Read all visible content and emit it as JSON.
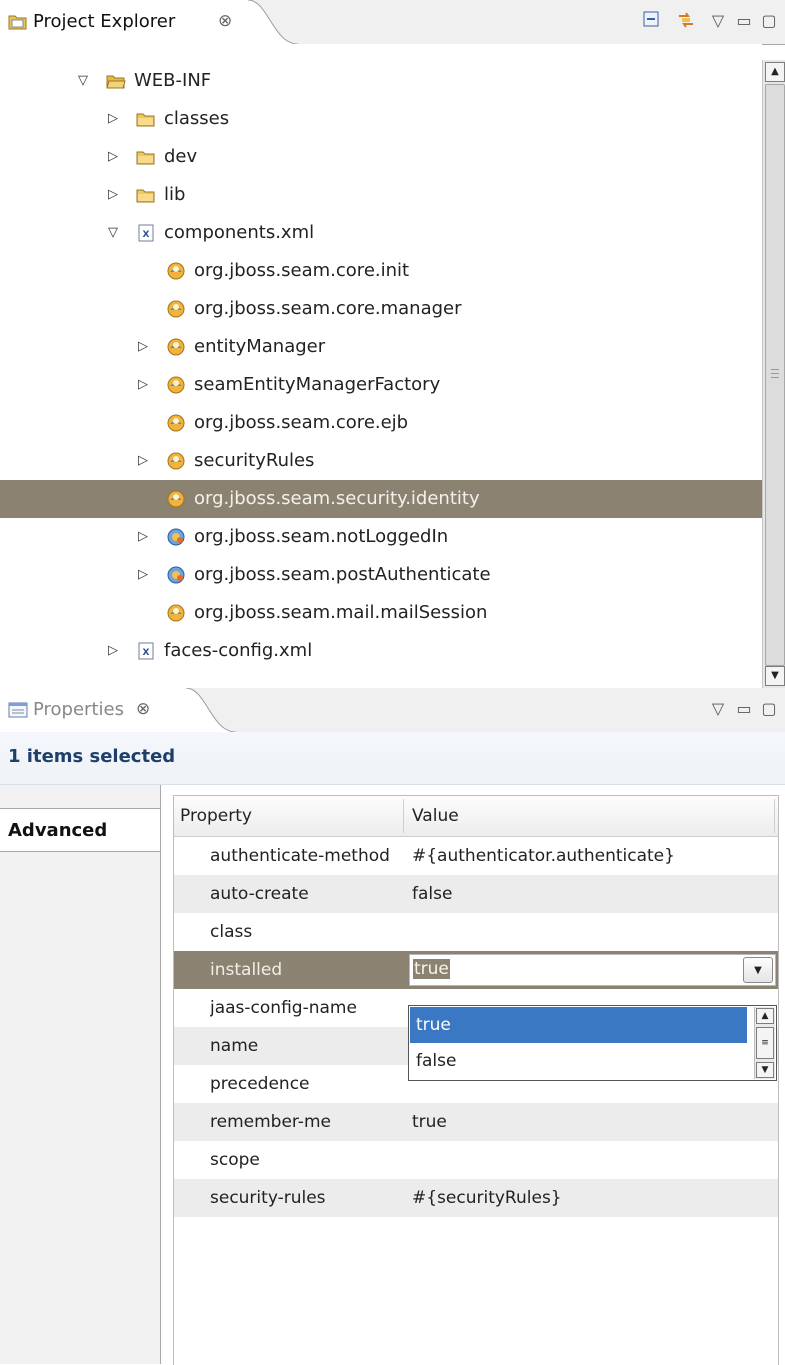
{
  "explorer": {
    "title": "Project Explorer",
    "close_glyph": "⊗",
    "toolbar": [
      "collapse-all-icon",
      "link-with-editor-icon",
      "view-menu-icon",
      "minimize-icon",
      "maximize-icon"
    ],
    "tree": [
      {
        "label": "WEB-INF",
        "expanded": true,
        "icon": "folder-open-icon"
      },
      {
        "label": "classes",
        "expanded": false,
        "icon": "folder-icon"
      },
      {
        "label": "dev",
        "expanded": false,
        "icon": "folder-icon"
      },
      {
        "label": "lib",
        "expanded": false,
        "icon": "folder-icon"
      },
      {
        "label": "components.xml",
        "expanded": true,
        "icon": "xml-file-icon"
      },
      {
        "label": "org.jboss.seam.core.init",
        "icon": "seam-component-icon"
      },
      {
        "label": "org.jboss.seam.core.manager",
        "icon": "seam-component-icon"
      },
      {
        "label": "entityManager",
        "expanded": false,
        "icon": "seam-component-icon"
      },
      {
        "label": "seamEntityManagerFactory",
        "expanded": false,
        "icon": "seam-component-icon"
      },
      {
        "label": "org.jboss.seam.core.ejb",
        "icon": "seam-component-icon"
      },
      {
        "label": "securityRules",
        "expanded": false,
        "icon": "seam-component-icon"
      },
      {
        "label": "org.jboss.seam.security.identity",
        "icon": "seam-component-icon",
        "selected": true
      },
      {
        "label": "org.jboss.seam.notLoggedIn",
        "expanded": false,
        "icon": "seam-event-icon"
      },
      {
        "label": "org.jboss.seam.postAuthenticate",
        "expanded": false,
        "icon": "seam-event-icon"
      },
      {
        "label": "org.jboss.seam.mail.mailSession",
        "icon": "seam-component-icon"
      },
      {
        "label": "faces-config.xml",
        "expanded": false,
        "icon": "xml-file-icon"
      }
    ]
  },
  "properties": {
    "title": "Properties",
    "close_glyph": "⊗",
    "selection_summary": "1 items selected",
    "tabs": [
      "Advanced"
    ],
    "columns": [
      "Property",
      "Value"
    ],
    "rows": [
      {
        "name": "authenticate-method",
        "value": "#{authenticator.authenticate}"
      },
      {
        "name": "auto-create",
        "value": "false"
      },
      {
        "name": "class",
        "value": ""
      },
      {
        "name": "installed",
        "value": "true",
        "editing": true
      },
      {
        "name": "jaas-config-name",
        "value": ""
      },
      {
        "name": "name",
        "value": ""
      },
      {
        "name": "precedence",
        "value": ""
      },
      {
        "name": "remember-me",
        "value": "true"
      },
      {
        "name": "scope",
        "value": ""
      },
      {
        "name": "security-rules",
        "value": "#{securityRules}"
      }
    ],
    "dropdown_options": [
      "true",
      "false"
    ],
    "dropdown_highlighted": "true"
  },
  "colors": {
    "selection": "#8b8272",
    "list_highlight": "#3a78c4",
    "summary_text": "#1f3f6b"
  }
}
